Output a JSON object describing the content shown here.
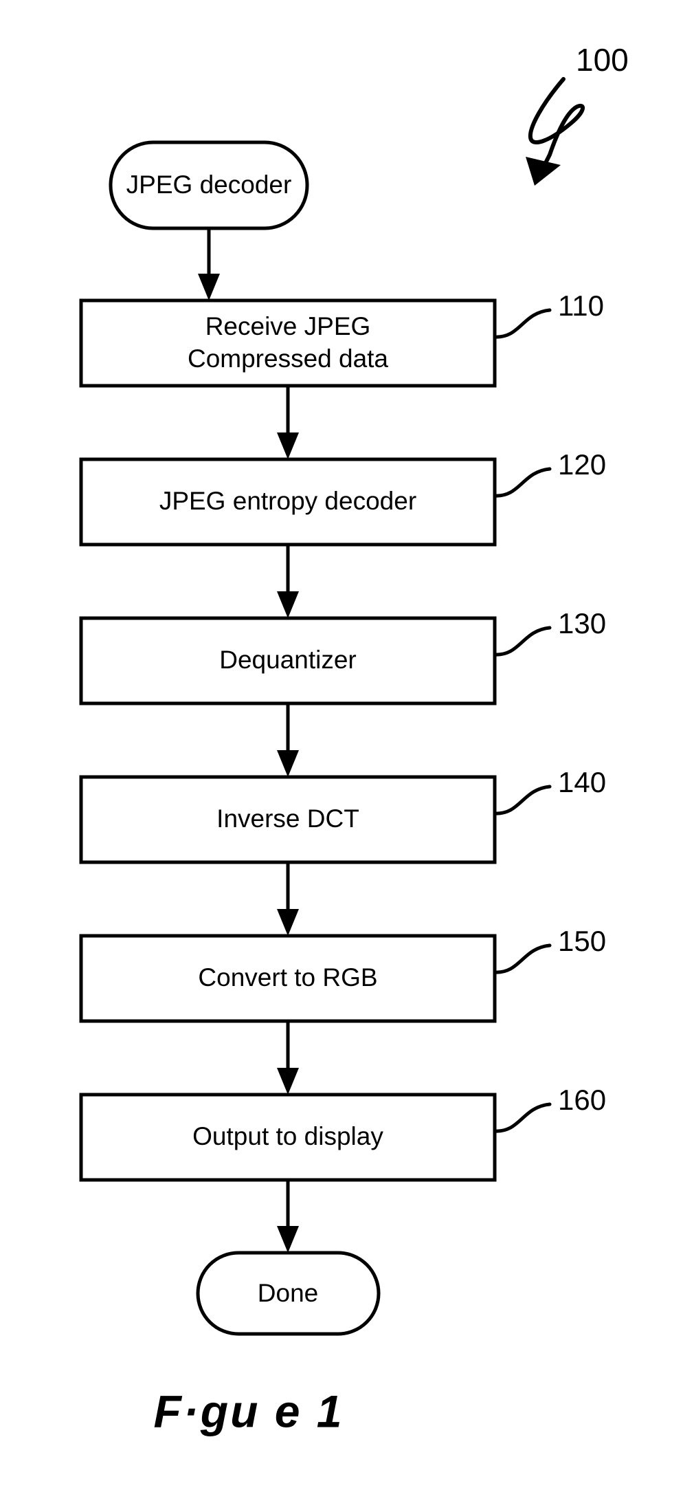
{
  "figure": {
    "reference_numeral": "100",
    "caption": "F·gu  e   1",
    "caption_intended": "Figure 1"
  },
  "flowchart": {
    "type": "flowchart",
    "orientation": "top-to-bottom",
    "start_terminator": {
      "label": "JPEG decoder",
      "shape": "rounded-terminator"
    },
    "end_terminator": {
      "label": "Done",
      "shape": "rounded-terminator"
    },
    "steps": [
      {
        "id": "110",
        "label_line1": "Receive JPEG",
        "label_line2": "Compressed data",
        "ref": "110",
        "shape": "rectangle"
      },
      {
        "id": "120",
        "label_line1": "JPEG entropy decoder",
        "label_line2": "",
        "ref": "120",
        "shape": "rectangle"
      },
      {
        "id": "130",
        "label_line1": "Dequantizer",
        "label_line2": "",
        "ref": "130",
        "shape": "rectangle"
      },
      {
        "id": "140",
        "label_line1": "Inverse DCT",
        "label_line2": "",
        "ref": "140",
        "shape": "rectangle"
      },
      {
        "id": "150",
        "label_line1": "Convert to RGB",
        "label_line2": "",
        "ref": "150",
        "shape": "rectangle"
      },
      {
        "id": "160",
        "label_line1": "Output to display",
        "label_line2": "",
        "ref": "160",
        "shape": "rectangle"
      }
    ]
  },
  "colors": {
    "line": "#000000",
    "fill": "#ffffff",
    "text": "#000000"
  }
}
